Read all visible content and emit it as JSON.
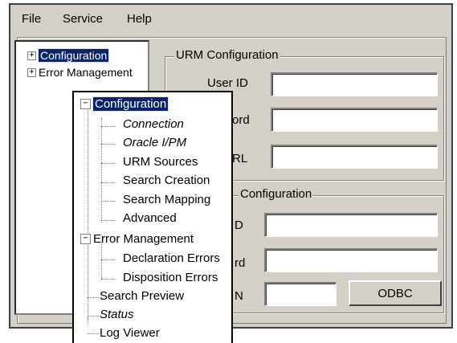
{
  "menu": {
    "file": "File",
    "service": "Service",
    "help": "Help"
  },
  "tree": {
    "configuration": "Configuration",
    "error_management": "Error Management"
  },
  "urm_group": {
    "title": "URM Configuration",
    "user_id_label": "User ID",
    "password_label": "ord",
    "url_label": "RL"
  },
  "second_group": {
    "title": "Configuration",
    "row1_label": "D",
    "row2_label": "rd",
    "row3_label": "N",
    "odbc_button": "ODBC"
  },
  "overlay_tree": {
    "configuration": "Configuration",
    "connection": "Connection",
    "oracle_ipm": "Oracle I/PM",
    "urm_sources": "URM Sources",
    "search_creation": "Search Creation",
    "search_mapping": "Search Mapping",
    "advanced": "Advanced",
    "error_management": "Error Management",
    "declaration_errors": "Declaration Errors",
    "disposition_errors": "Disposition Errors",
    "search_preview": "Search Preview",
    "status": "Status",
    "log_viewer": "Log Viewer"
  }
}
